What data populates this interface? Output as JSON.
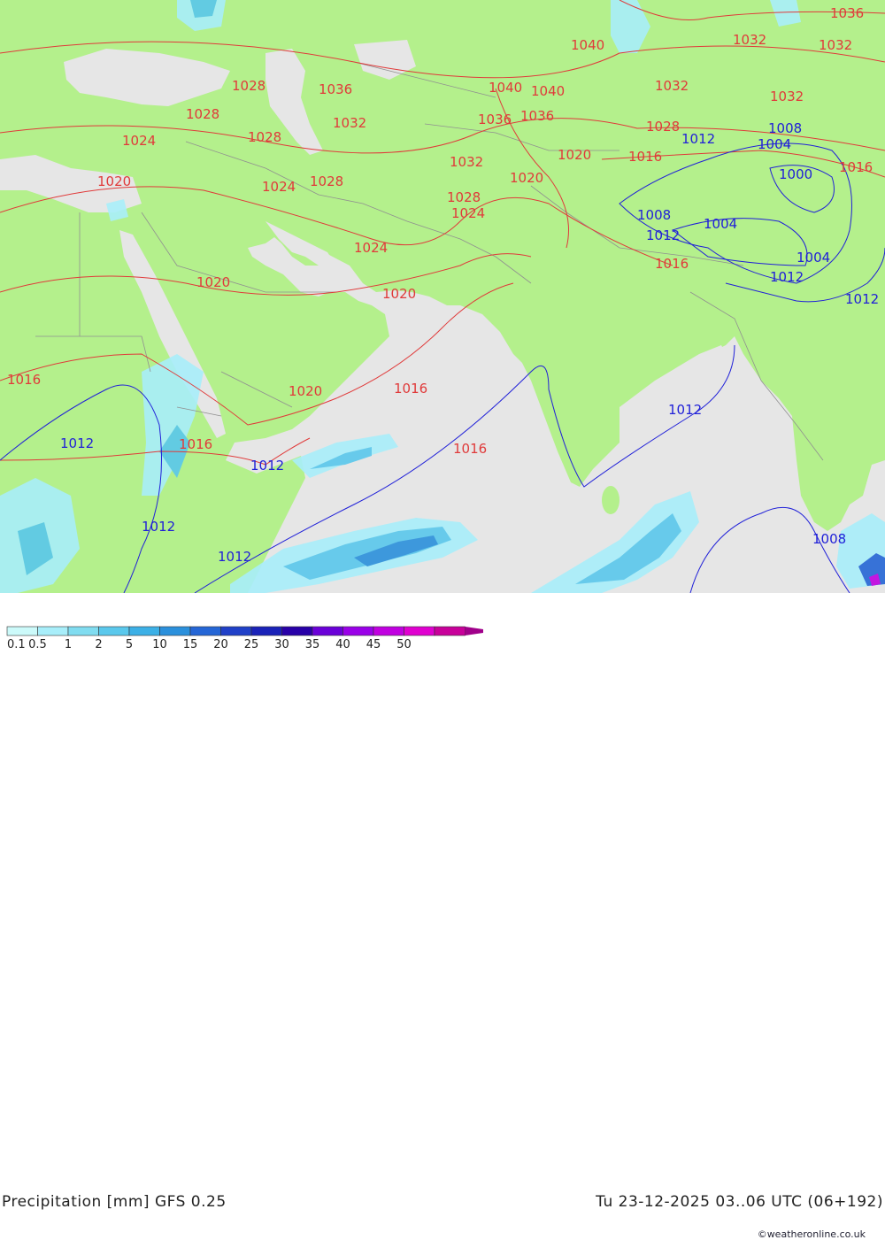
{
  "title": {
    "left": "Precipitation [mm]  GFS 0.25",
    "right": "Tu 23-12-2025 03..06 UTC (06+192)"
  },
  "credit": "©weatheronline.co.uk",
  "legend": {
    "colors": [
      "#ccfafa",
      "#a8eefa",
      "#80dcf0",
      "#5ac8ec",
      "#3cb0e6",
      "#2b90dc",
      "#2566d6",
      "#2040c8",
      "#1a22b8",
      "#2800a8",
      "#6a00d8",
      "#9a00e8",
      "#c000e0",
      "#e000d0",
      "#c8009a"
    ],
    "labels": [
      "0.1",
      "0.5",
      "1",
      "2",
      "5",
      "10",
      "15",
      "20",
      "25",
      "30",
      "35",
      "40",
      "45",
      "50"
    ]
  },
  "map_colors": {
    "land": "#b4f08c",
    "sea": "#e6e6e6",
    "isobar_high": "#e03a3a",
    "isobar_low": "#2020d8",
    "border": "#909090"
  },
  "isobar_labels": [
    {
      "text": "1036",
      "color": "red"
    },
    {
      "text": "1040",
      "color": "red"
    },
    {
      "text": "1032",
      "color": "red"
    },
    {
      "text": "1032",
      "color": "red"
    },
    {
      "text": "1028",
      "color": "red"
    },
    {
      "text": "1036",
      "color": "red"
    },
    {
      "text": "1040",
      "color": "red"
    },
    {
      "text": "1040",
      "color": "red"
    },
    {
      "text": "1032",
      "color": "red"
    },
    {
      "text": "1032",
      "color": "red"
    },
    {
      "text": "1028",
      "color": "red"
    },
    {
      "text": "1032",
      "color": "red"
    },
    {
      "text": "1036",
      "color": "red"
    },
    {
      "text": "1036",
      "color": "red"
    },
    {
      "text": "1028",
      "color": "red"
    },
    {
      "text": "1008",
      "color": "blue"
    },
    {
      "text": "1028",
      "color": "red"
    },
    {
      "text": "1024",
      "color": "red"
    },
    {
      "text": "1012",
      "color": "blue"
    },
    {
      "text": "1004",
      "color": "blue"
    },
    {
      "text": "1020",
      "color": "red"
    },
    {
      "text": "1016",
      "color": "red"
    },
    {
      "text": "1016",
      "color": "red"
    },
    {
      "text": "1032",
      "color": "red"
    },
    {
      "text": "1000",
      "color": "blue"
    },
    {
      "text": "1020",
      "color": "red"
    },
    {
      "text": "1020",
      "color": "red"
    },
    {
      "text": "1024",
      "color": "red"
    },
    {
      "text": "1028",
      "color": "red"
    },
    {
      "text": "1028",
      "color": "red"
    },
    {
      "text": "1024",
      "color": "red"
    },
    {
      "text": "1008",
      "color": "blue"
    },
    {
      "text": "1004",
      "color": "blue"
    },
    {
      "text": "1012",
      "color": "blue"
    },
    {
      "text": "1024",
      "color": "red"
    },
    {
      "text": "1004",
      "color": "blue"
    },
    {
      "text": "1016",
      "color": "red"
    },
    {
      "text": "1020",
      "color": "red"
    },
    {
      "text": "1012",
      "color": "blue"
    },
    {
      "text": "1020",
      "color": "red"
    },
    {
      "text": "1012",
      "color": "blue"
    },
    {
      "text": "1016",
      "color": "red"
    },
    {
      "text": "1020",
      "color": "red"
    },
    {
      "text": "1016",
      "color": "red"
    },
    {
      "text": "1012",
      "color": "blue"
    },
    {
      "text": "1012",
      "color": "blue"
    },
    {
      "text": "1016",
      "color": "red"
    },
    {
      "text": "1016",
      "color": "red"
    },
    {
      "text": "1012",
      "color": "blue"
    },
    {
      "text": "1012",
      "color": "blue"
    },
    {
      "text": "1012",
      "color": "blue"
    },
    {
      "text": "1008",
      "color": "blue"
    }
  ]
}
